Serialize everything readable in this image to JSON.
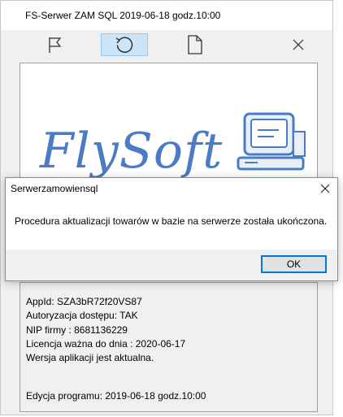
{
  "window": {
    "title": "FS-Serwer ZAM SQL  2019-06-18 godz.10:00"
  },
  "toolbar": {
    "buttons": [
      {
        "icon": "flag-icon"
      },
      {
        "icon": "refresh-icon"
      },
      {
        "icon": "document-icon"
      },
      {
        "icon": "close-icon"
      }
    ],
    "active_color": "#cce4f7"
  },
  "logo": {
    "text": "FlySoft",
    "color": "#4b7bc4"
  },
  "info": {
    "lines": [
      "AppId: SZA3bR72f20VS87",
      "Autoryzacja dostępu: TAK",
      "NIP firmy : 8681136229",
      "Licencja ważna do dnia : 2020-06-17",
      "Wersja aplikacji jest aktualna."
    ],
    "edition": "Edycja programu: 2019-06-18 godz.10:00"
  },
  "dialog": {
    "title": "Serwerzamowiensql",
    "message": "Procedura aktualizacji towarów w bazie na serwerze została ukończona.",
    "ok_label": "OK",
    "accent": "#0078d7"
  }
}
